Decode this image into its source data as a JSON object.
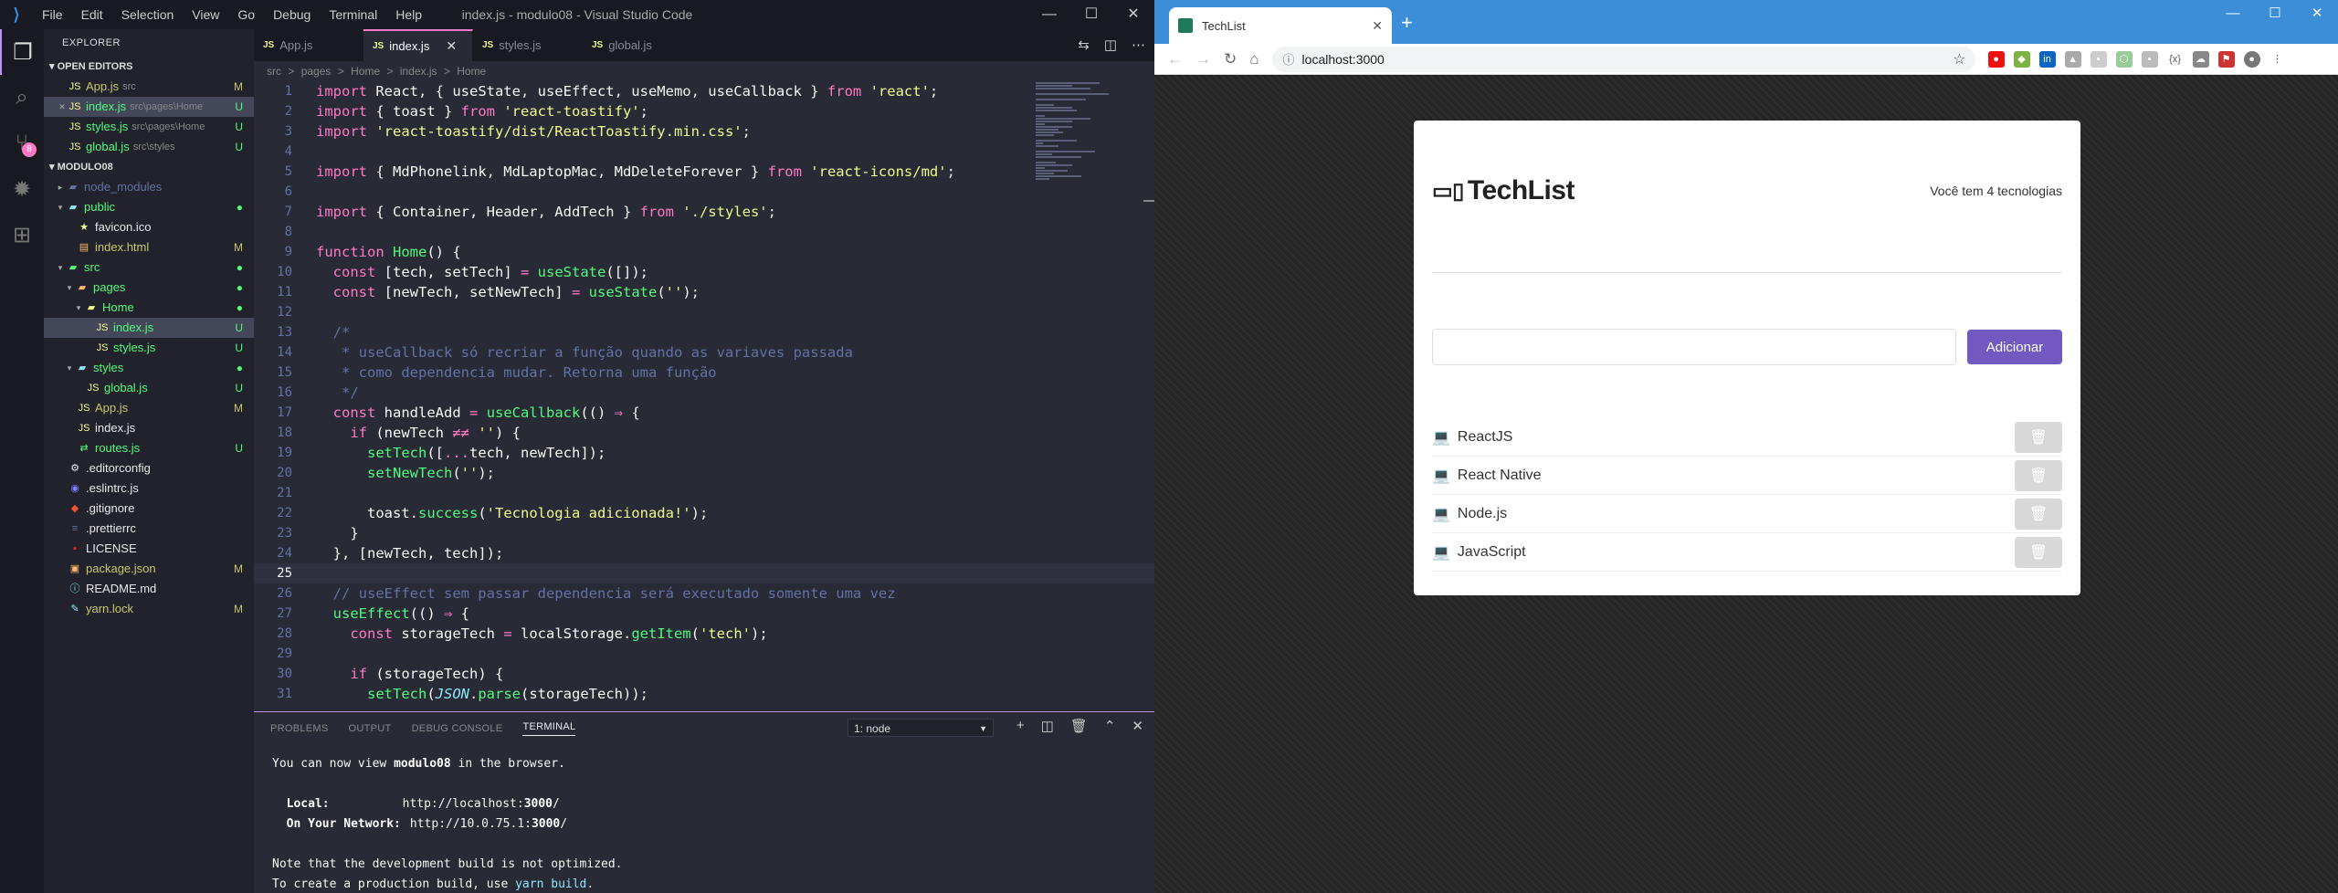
{
  "vscode": {
    "title": "index.js - modulo08 - Visual Studio Code",
    "menu": [
      "File",
      "Edit",
      "Selection",
      "View",
      "Go",
      "Debug",
      "Terminal",
      "Help"
    ],
    "explorer_title": "EXPLORER",
    "open_editors_label": "OPEN EDITORS",
    "project_label": "MODULO08",
    "scm_badge": "8",
    "open_editors": [
      {
        "name": "App.js",
        "path": "src",
        "status": "M"
      },
      {
        "name": "index.js",
        "path": "src\\pages\\Home",
        "status": "U"
      },
      {
        "name": "styles.js",
        "path": "src\\pages\\Home",
        "status": "U"
      },
      {
        "name": "global.js",
        "path": "src\\styles",
        "status": "U"
      }
    ],
    "tree": [
      {
        "name": "node_modules",
        "status": ""
      },
      {
        "name": "public",
        "status": "●"
      },
      {
        "name": "favicon.ico",
        "status": ""
      },
      {
        "name": "index.html",
        "status": "M"
      },
      {
        "name": "src",
        "status": "●"
      },
      {
        "name": "pages",
        "status": "●"
      },
      {
        "name": "Home",
        "status": "●"
      },
      {
        "name": "index.js",
        "status": "U"
      },
      {
        "name": "styles.js",
        "status": "U"
      },
      {
        "name": "styles",
        "status": "●"
      },
      {
        "name": "global.js",
        "status": "U"
      },
      {
        "name": "App.js",
        "status": "M"
      },
      {
        "name": "index.js",
        "status": ""
      },
      {
        "name": "routes.js",
        "status": "U"
      },
      {
        "name": ".editorconfig",
        "status": ""
      },
      {
        "name": ".eslintrc.js",
        "status": ""
      },
      {
        "name": ".gitignore",
        "status": ""
      },
      {
        "name": ".prettierrc",
        "status": ""
      },
      {
        "name": "LICENSE",
        "status": ""
      },
      {
        "name": "package.json",
        "status": "M"
      },
      {
        "name": "README.md",
        "status": ""
      },
      {
        "name": "yarn.lock",
        "status": "M"
      }
    ],
    "tabs": [
      "App.js",
      "index.js",
      "styles.js",
      "global.js"
    ],
    "breadcrumb": [
      "src",
      ">",
      "pages",
      ">",
      "Home",
      ">",
      "index.js",
      ">",
      "Home"
    ],
    "current_line": "25",
    "panel_tabs": [
      "PROBLEMS",
      "OUTPUT",
      "DEBUG CONSOLE",
      "TERMINAL"
    ],
    "terminal_select": "1: node",
    "terminal": {
      "line1_a": "You can now view ",
      "line1_b": "modulo08",
      "line1_c": " in the browser.",
      "local_label": "  Local:",
      "local_url_a": "http://localhost:",
      "local_url_b": "3000",
      "local_url_c": "/",
      "net_label": "  On Your Network:",
      "net_url_a": "http://10.0.75.1:",
      "net_url_b": "3000",
      "net_url_c": "/",
      "note": "Note that the development build is not optimized.",
      "prod_a": "To create a production build, use ",
      "prod_b": "yarn build",
      "prod_c": "."
    }
  },
  "browser": {
    "tab_title": "TechList",
    "url": "localhost:3000",
    "app": {
      "brand": "TechList",
      "count_text": "Você tem 4 tecnologias",
      "input_value": "",
      "add_label": "Adicionar",
      "techs": [
        "ReactJS",
        "React Native",
        "Node.js",
        "JavaScript"
      ]
    }
  }
}
